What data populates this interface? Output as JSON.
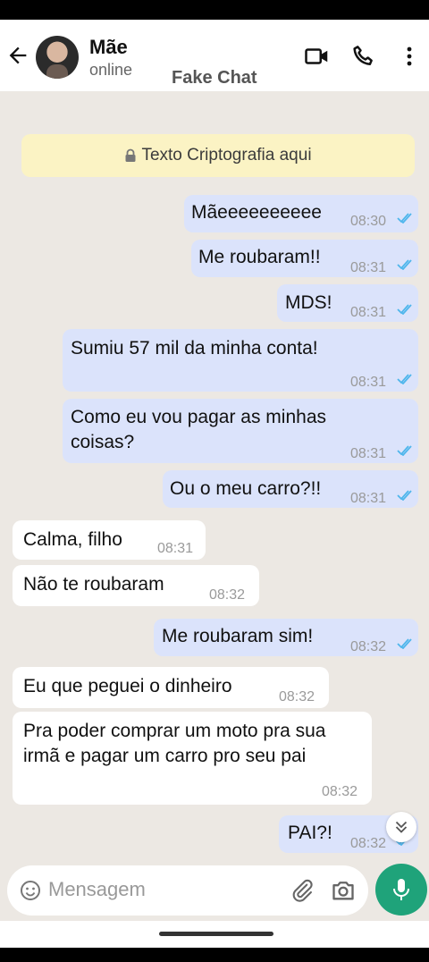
{
  "header": {
    "contact_name": "Mãe",
    "contact_status": "online",
    "watermark": "Fake Chat"
  },
  "encryption_notice": "Texto Criptografia aqui",
  "messages": [
    {
      "side": "out",
      "text": "Mãeeeeeeeeee",
      "time": "08:30",
      "read": true
    },
    {
      "side": "out",
      "text": "Me roubaram!!",
      "time": "08:31",
      "read": true
    },
    {
      "side": "out",
      "text": "MDS!",
      "time": "08:31",
      "read": true
    },
    {
      "side": "out",
      "text": "Sumiu 57 mil da minha conta!",
      "time": "08:31",
      "read": true
    },
    {
      "side": "out",
      "text": "Como eu vou pagar as minhas coisas?",
      "time": "08:31",
      "read": true
    },
    {
      "side": "out",
      "text": "Ou o meu carro?!!",
      "time": "08:31",
      "read": true
    },
    {
      "side": "in",
      "text": "Calma, filho",
      "time": "08:31"
    },
    {
      "side": "in",
      "text": "Não te roubaram",
      "time": "08:32"
    },
    {
      "side": "out",
      "text": "Me roubaram sim!",
      "time": "08:32",
      "read": true
    },
    {
      "side": "in",
      "text": "Eu que peguei o dinheiro",
      "time": "08:32"
    },
    {
      "side": "in",
      "text": "Pra poder comprar um moto pra sua irmã e pagar um carro pro seu pai",
      "time": "08:32"
    },
    {
      "side": "out",
      "text": "PAI?!",
      "time": "08:32",
      "read": true
    }
  ],
  "composer": {
    "placeholder": "Mensagem"
  },
  "colors": {
    "outgoing_bubble": "#dbe3fb",
    "incoming_bubble": "#ffffff",
    "chat_background": "#ece8e3",
    "encryption_banner": "#fbf3c4",
    "mic_button": "#1fa37a",
    "read_check": "#4fb6ec"
  },
  "icons": [
    "back-arrow-icon",
    "video-call-icon",
    "phone-icon",
    "more-vert-icon",
    "lock-icon",
    "double-check-icon",
    "emoji-icon",
    "attach-icon",
    "camera-icon",
    "mic-icon",
    "chevrons-down-icon"
  ]
}
